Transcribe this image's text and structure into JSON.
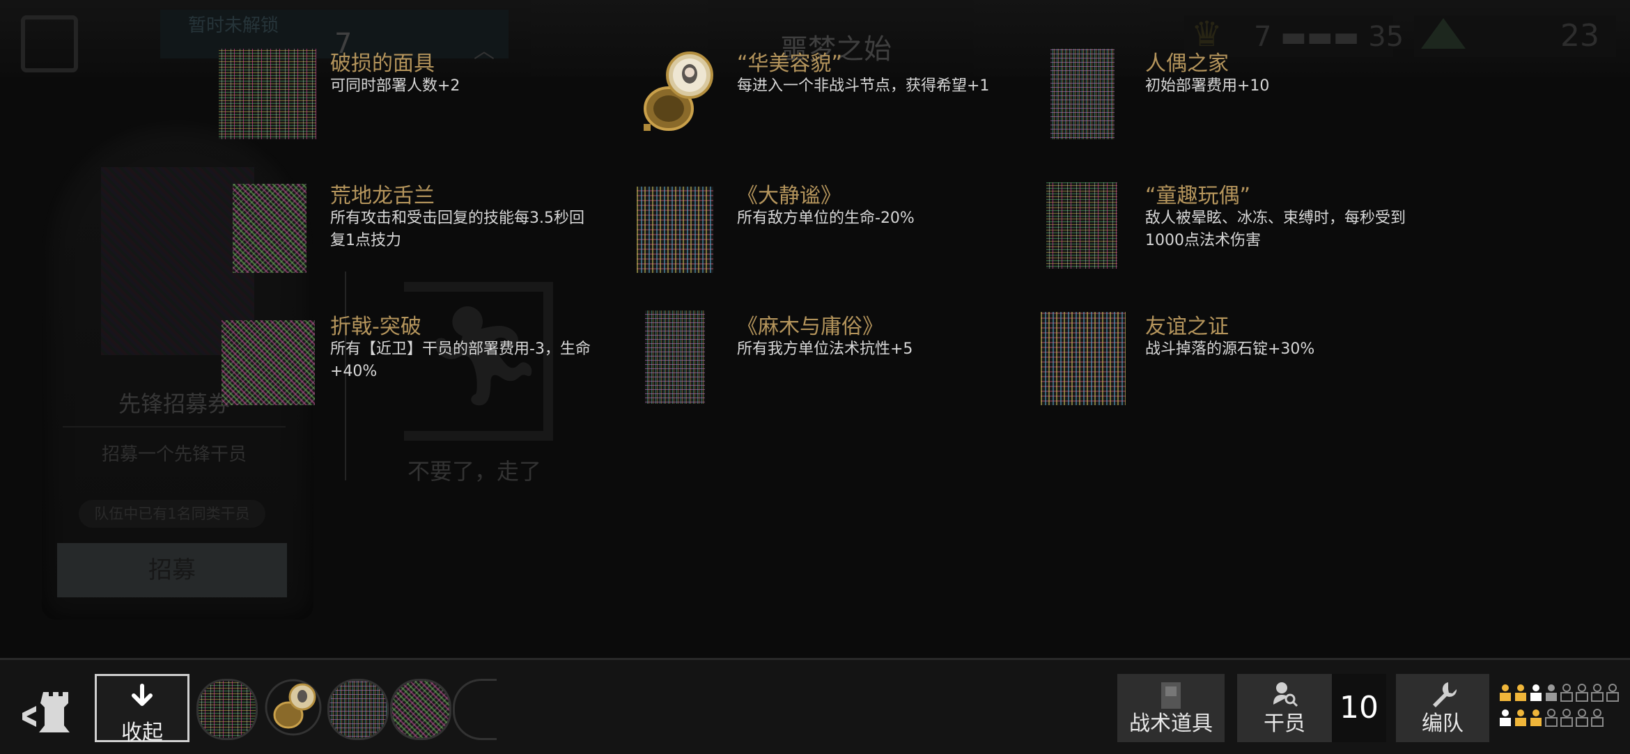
{
  "background": {
    "stage_name": "暂时未解锁",
    "stage_number": "7",
    "title": "噩梦之始",
    "hope_value": "7",
    "hope_max": "35",
    "ingot_value": "23",
    "card": {
      "title": "先锋招募券",
      "description": "招募一个先锋干员",
      "pill": "队伍中已有1名同类干员",
      "button": "招募"
    },
    "leave_text": "不要了，走了"
  },
  "relics": [
    {
      "name": "破损的面具",
      "description": "可同时部署人数+2",
      "icon": "mask-icon"
    },
    {
      "name": "“华美容貌”",
      "description": "每进入一个非战斗节点，获得希望+1",
      "icon": "pocket-watch-icon"
    },
    {
      "name": "人偶之家",
      "description": "初始部署费用+10",
      "icon": "dollhouse-icon"
    },
    {
      "name": "荒地龙舌兰",
      "description": "所有攻击和受击回复的技能每3.5秒回复1点技力",
      "icon": "agave-icon"
    },
    {
      "name": "《大静谧》",
      "description": "所有敌方单位的生命-20%",
      "icon": "book-icon"
    },
    {
      "name": "“童趣玩偶”",
      "description": "敌人被晕眩、冰冻、束缚时，每秒受到1000点法术伤害",
      "icon": "toy-doll-icon"
    },
    {
      "name": "折戟-突破",
      "description": "所有【近卫】干员的部署费用-3，生命+40%",
      "icon": "broken-halberd-icon"
    },
    {
      "name": "《麻木与庸俗》",
      "description": "所有我方单位法术抗性+5",
      "icon": "book-icon"
    },
    {
      "name": "友谊之证",
      "description": "战斗掉落的源石锭+30%",
      "icon": "friendship-token-icon"
    }
  ],
  "bottom_bar": {
    "collapse_label": "收起",
    "tactical_items_label": "战术道具",
    "operators_label": "干员",
    "operator_count": "10",
    "squad_label": "编队"
  }
}
